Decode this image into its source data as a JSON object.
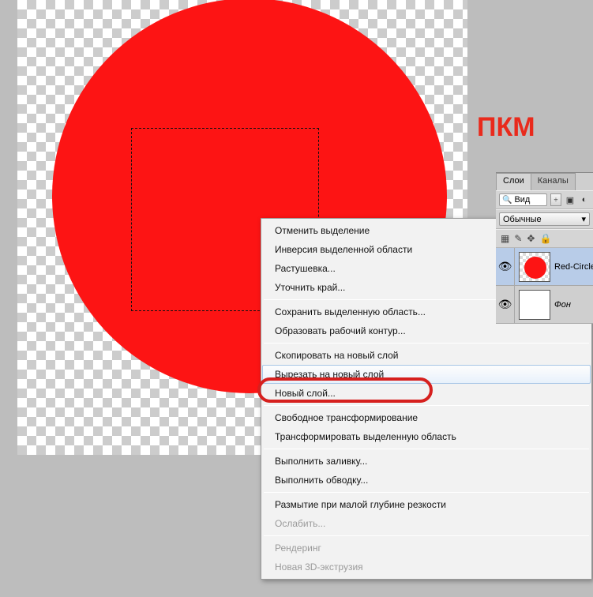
{
  "annotation": "ПКМ",
  "context_menu": {
    "items": [
      {
        "label": "Отменить выделение",
        "type": "item"
      },
      {
        "label": "Инверсия выделенной области",
        "type": "item"
      },
      {
        "label": "Растушевка...",
        "type": "item"
      },
      {
        "label": "Уточнить край...",
        "type": "item"
      },
      {
        "type": "sep"
      },
      {
        "label": "Сохранить выделенную область...",
        "type": "item"
      },
      {
        "label": "Образовать рабочий контур...",
        "type": "item"
      },
      {
        "type": "sep"
      },
      {
        "label": "Скопировать на новый слой",
        "type": "item"
      },
      {
        "label": "Вырезать на новый слой",
        "type": "item",
        "hovered": true
      },
      {
        "label": "Новый слой...",
        "type": "item"
      },
      {
        "type": "sep"
      },
      {
        "label": "Свободное трансформирование",
        "type": "item"
      },
      {
        "label": "Трансформировать выделенную область",
        "type": "item"
      },
      {
        "type": "sep"
      },
      {
        "label": "Выполнить заливку...",
        "type": "item"
      },
      {
        "label": "Выполнить обводку...",
        "type": "item"
      },
      {
        "type": "sep"
      },
      {
        "label": "Размытие при малой глубине резкости",
        "type": "item"
      },
      {
        "label": "Ослабить...",
        "type": "item",
        "disabled": true
      },
      {
        "type": "sep"
      },
      {
        "label": "Рендеринг",
        "type": "item",
        "disabled": true
      },
      {
        "label": "Новая 3D-экструзия",
        "type": "item",
        "disabled": true
      }
    ]
  },
  "panel": {
    "tabs": {
      "layers": "Слои",
      "channels": "Каналы"
    },
    "search_label": "Вид",
    "blend_mode": "Обычные",
    "layers": [
      {
        "name": "Red-Circle-Funa",
        "selected": true,
        "thumb": "circle"
      },
      {
        "name": "Фон",
        "selected": false,
        "thumb": "white",
        "italic": true
      }
    ]
  }
}
